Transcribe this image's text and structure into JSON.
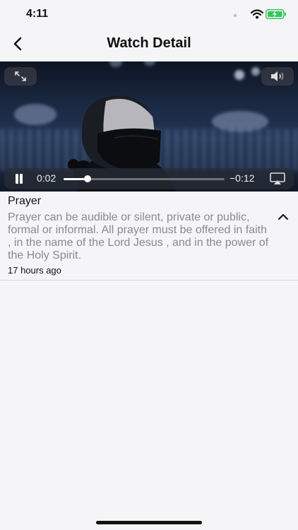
{
  "status": {
    "time": "4:11"
  },
  "nav": {
    "title": "Watch Detail"
  },
  "video": {
    "current_time": "0:02",
    "remaining_time": "−0:12",
    "progress": 0.15
  },
  "post": {
    "title": "Prayer",
    "body": "Prayer can be audible or silent, private or public, formal or informal. All prayer must be offered in faith , in the name of the Lord Jesus , and in the power of the Holy Spirit.",
    "timestamp": "17 hours ago"
  }
}
